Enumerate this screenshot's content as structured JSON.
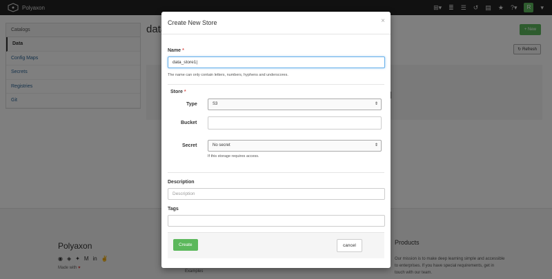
{
  "app": {
    "brand": "Polyaxon",
    "avatar_initial": "R"
  },
  "nav_icons": [
    "plus-square-icon",
    "list-icon",
    "list-alt-icon",
    "history-icon",
    "archive-icon",
    "star-icon",
    "help-icon"
  ],
  "sidebar": {
    "header": "Catalogs",
    "items": [
      {
        "label": "Data",
        "active": true
      },
      {
        "label": "Config Maps"
      },
      {
        "label": "Secrets"
      },
      {
        "label": "Registries"
      },
      {
        "label": "Git"
      }
    ]
  },
  "page": {
    "title": "data",
    "new_label": "+ New",
    "refresh_label": "Refresh",
    "bg_text": "d"
  },
  "footer": {
    "brand": "Polyaxon",
    "made_with": "Made with",
    "heart": "♥",
    "products_title": "Products",
    "mission": "Our mission is to make deep learning simple and accessible to enterprises. If you have special requirements, get in touch with our team.",
    "examples": "Examples"
  },
  "modal": {
    "title": "Create New Store",
    "close": "×",
    "name_label": "Name",
    "required_mark": "*",
    "name_value": "data_store1|",
    "name_help": "The name can only contain letters, numbers, hyphens and underscores.",
    "store_label": "Store",
    "type_label": "Type",
    "type_value": "S3",
    "bucket_label": "Bucket",
    "bucket_value": "",
    "secret_label": "Secret",
    "secret_value": "No secret",
    "secret_help": "If this storage requires access.",
    "description_label": "Description",
    "description_placeholder": "Description",
    "tags_label": "Tags",
    "tags_value": "",
    "create_label": "Create",
    "cancel_label": "cancel"
  },
  "colors": {
    "primary_green": "#5cb85c",
    "nav_bg": "#222222",
    "required_red": "#d9534f",
    "link_blue": "#2a6496"
  }
}
